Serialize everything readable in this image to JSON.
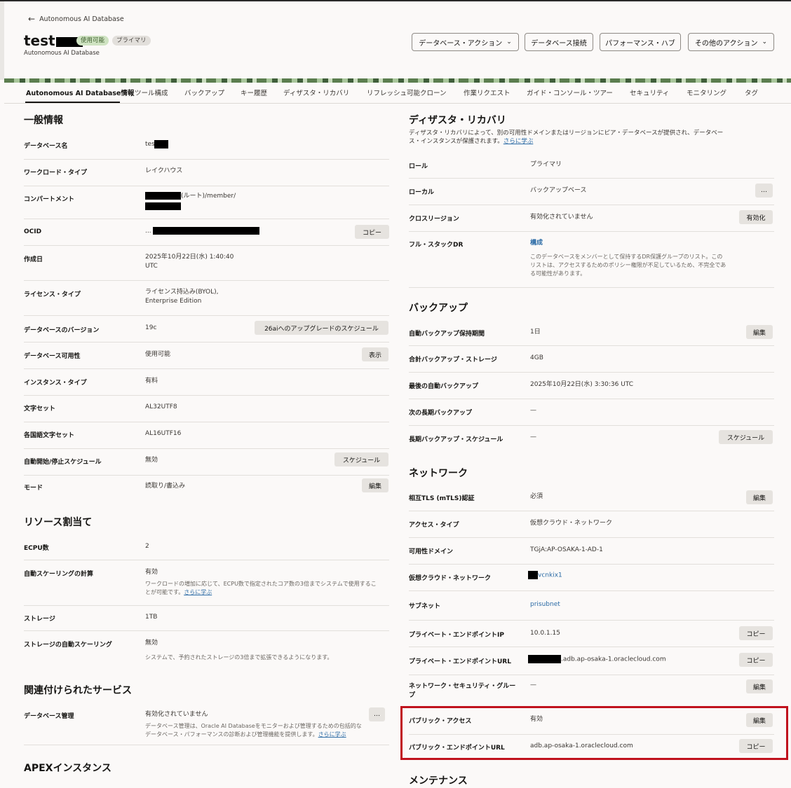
{
  "header": {
    "back_label": "Autonomous AI Database",
    "title": "test",
    "status_available": "使用可能",
    "status_role": "プライマリ",
    "subtitle": "Autonomous AI Database"
  },
  "actions": {
    "db_actions": "データベース・アクション",
    "db_connect": "データベース接続",
    "perf_hub": "パフォーマンス・ハブ",
    "other_actions": "その他のアクション"
  },
  "tabs": [
    "Autonomous AI Database情報",
    "ツール構成",
    "バックアップ",
    "キー履歴",
    "ディザスタ・リカバリ",
    "リフレッシュ可能クローン",
    "作業リクエスト",
    "ガイド・コンソール・ツアー",
    "セキュリティ",
    "モニタリング",
    "タグ"
  ],
  "general": {
    "title": "一般情報",
    "db_name_label": "データベース名",
    "db_name_value": "test",
    "workload_label": "ワークロード・タイプ",
    "workload_value": "レイクハウス",
    "compartment_label": "コンパートメント",
    "compartment_value": "(ルート)/member/",
    "ocid_label": "OCID",
    "ocid_value": "...",
    "copy": "コピー",
    "created_label": "作成日",
    "created_value_1": "2025年10月22日(水) 1:40:40",
    "created_value_2": "UTC",
    "license_label": "ライセンス・タイプ",
    "license_value_1": "ライセンス持込み(BYOL),",
    "license_value_2": "Enterprise Edition",
    "version_label": "データベースのバージョン",
    "version_value": "19c",
    "upgrade_btn": "26aiへのアップグレードのスケジュール",
    "availability_label": "データベース可用性",
    "availability_value": "使用可能",
    "show_btn": "表示",
    "instance_label": "インスタンス・タイプ",
    "instance_value": "有料",
    "charset_label": "文字セット",
    "charset_value": "AL32UTF8",
    "ncharset_label": "各国語文字セット",
    "ncharset_value": "AL16UTF16",
    "autostart_label": "自動開始/停止スケジュール",
    "autostart_value": "無効",
    "schedule_btn": "スケジュール",
    "mode_label": "モード",
    "mode_value": "読取り/書込み",
    "edit_btn": "編集"
  },
  "resources": {
    "title": "リソース割当て",
    "ecpu_label": "ECPU数",
    "ecpu_value": "2",
    "autoscale_label": "自動スケーリングの計算",
    "autoscale_value": "有効",
    "autoscale_desc_1": "ワークロードの増加に応じて、ECPU数で指定されたコア数の3倍までシステムで使用するこ",
    "autoscale_desc_2": "とが可能です。",
    "learn_more": "さらに学ぶ",
    "storage_label": "ストレージ",
    "storage_value": "1TB",
    "storage_auto_label": "ストレージの自動スケーリング",
    "storage_auto_value": "無効",
    "storage_auto_desc": "システムで、予約されたストレージの3倍まで拡張できるようになります。"
  },
  "related": {
    "title": "関連付けられたサービス",
    "dbmgmt_label": "データベース管理",
    "dbmgmt_value": "有効化されていません",
    "dbmgmt_desc_1": "データベース管理は、Oracle AI Databaseをモニターおよび管理するための包括的な",
    "dbmgmt_desc_2": "データベース・パフォーマンスの診断および管理機能を提供します。",
    "learn_more": "さらに学ぶ",
    "more": "…"
  },
  "apex": {
    "title": "APEXインスタンス"
  },
  "dr": {
    "title": "ディザスタ・リカバリ",
    "desc_1": "ディザスタ・リカバリによって、別の可用性ドメインまたはリージョンにピア・データベースが提供され、データベー",
    "desc_2": "ス・インスタンスが保護されます。",
    "learn_more": "さらに学ぶ",
    "role_label": "ロール",
    "role_value": "プライマリ",
    "local_label": "ローカル",
    "local_value": "バックアップベース",
    "more": "…",
    "cross_label": "クロスリージョン",
    "cross_value": "有効化されていません",
    "enable_btn": "有効化",
    "fullstack_label": "フル・スタックDR",
    "fullstack_value": "構成",
    "fullstack_desc_1": "このデータベースをメンバーとして保持するDR保護グループのリスト。この",
    "fullstack_desc_2": "リストは、アクセスするためのポリシー権限が不足しているため、不完全であ",
    "fullstack_desc_3": "る可能性があります。"
  },
  "backup": {
    "title": "バックアップ",
    "retention_label": "自動バックアップ保持期間",
    "retention_value": "1日",
    "edit_btn": "編集",
    "storage_label": "合計バックアップ・ストレージ",
    "storage_value": "4GB",
    "last_label": "最後の自動バックアップ",
    "last_value": "2025年10月22日(水) 3:30:36 UTC",
    "next_long_label": "次の長期バックアップ",
    "next_long_value": "—",
    "long_sched_label": "長期バックアップ・スケジュール",
    "long_sched_value": "—",
    "schedule_btn": "スケジュール"
  },
  "network": {
    "title": "ネットワーク",
    "mtls_label": "相互TLS (mTLS)認証",
    "mtls_value": "必須",
    "edit_btn": "編集",
    "access_label": "アクセス・タイプ",
    "access_value": "仮想クラウド・ネットワーク",
    "ad_label": "可用性ドメイン",
    "ad_value": "TGjA:AP-OSAKA-1-AD-1",
    "vcn_label": "仮想クラウド・ネットワーク",
    "vcn_value": "vcnkix1",
    "subnet_label": "サブネット",
    "subnet_value": "prisubnet",
    "pe_ip_label": "プライベート・エンドポイントIP",
    "pe_ip_value": "10.0.1.15",
    "copy": "コピー",
    "pe_url_label": "プライベート・エンドポイントURL",
    "pe_url_value": ".adb.ap-osaka-1.oraclecloud.com",
    "nsg_label_1": "ネットワーク・セキュリティ・グルー",
    "nsg_label_2": "プ",
    "nsg_value": "—",
    "public_label": "パブリック・アクセス",
    "public_value": "有効",
    "public_url_label": "パブリック・エンドポイントURL",
    "public_url_value": "adb.ap-osaka-1.oraclecloud.com"
  },
  "maintenance": {
    "title": "メンテナンス"
  }
}
